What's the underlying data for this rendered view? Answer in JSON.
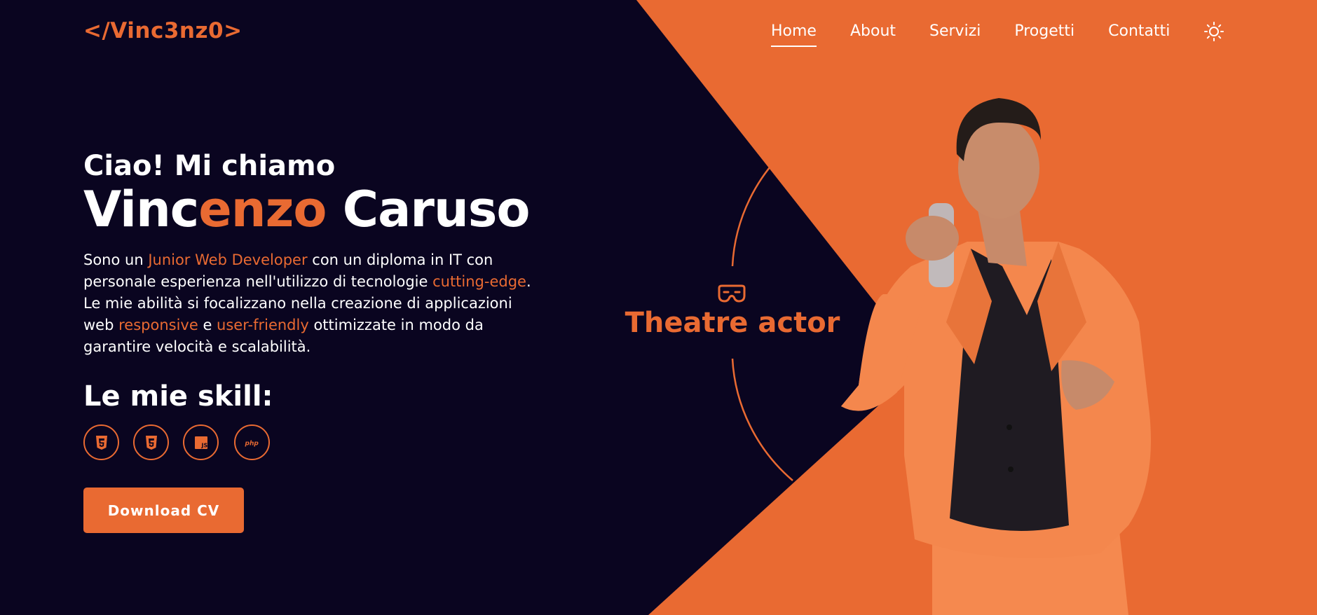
{
  "header": {
    "logo": "</Vinc3nz0>",
    "nav": [
      "Home",
      "About",
      "Servizi",
      "Progetti",
      "Contatti"
    ],
    "active": "Home",
    "theme_icon": "sun-icon"
  },
  "hero": {
    "greeting": "Ciao! Mi chiamo",
    "name_part1": "Vinc",
    "name_accent": "enzo",
    "name_part2": " Caruso",
    "bio": {
      "t1": "Sono un ",
      "h1": "Junior Web Developer",
      "t2": " con un diploma in IT con personale esperienza nell'utilizzo di tecnologie ",
      "h2": "cutting-edge",
      "t3": ". Le mie abilità si focalizzano nella creazione di applicazioni web ",
      "h3": "responsive",
      "t4": " e ",
      "h4": "user-friendly",
      "t5": " ottimizzate in modo da garantire velocità e scalabilità."
    },
    "skills_title": "Le mie skill:",
    "skills": [
      "html5-icon",
      "css3-icon",
      "js-icon",
      "php-icon"
    ],
    "download_label": "Download CV"
  },
  "role": {
    "icon": "theatre-mask-icon",
    "label": "Theatre actor"
  },
  "colors": {
    "accent": "#e96a32",
    "background": "#0a0520",
    "text": "#ffffff"
  }
}
